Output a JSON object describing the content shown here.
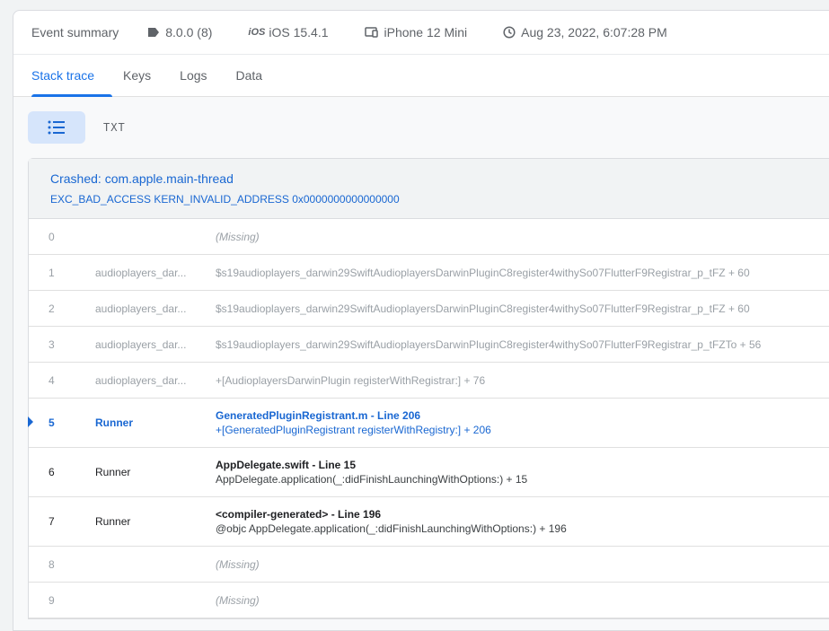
{
  "summary": {
    "title": "Event summary",
    "version": "8.0.0 (8)",
    "os": "iOS 15.4.1",
    "os_glyph": "iOS",
    "device": "iPhone 12 Mini",
    "timestamp": "Aug 23, 2022, 6:07:28 PM"
  },
  "tabs": [
    {
      "label": "Stack trace",
      "active": true
    },
    {
      "label": "Keys"
    },
    {
      "label": "Logs"
    },
    {
      "label": "Data"
    }
  ],
  "view_toggle": {
    "txt_label": "TXT"
  },
  "crash": {
    "title": "Crashed: com.apple.main-thread",
    "subtitle": "EXC_BAD_ACCESS KERN_INVALID_ADDRESS 0x0000000000000000"
  },
  "frames": [
    {
      "num": "0",
      "lib": "",
      "symbol": "(Missing)"
    },
    {
      "num": "1",
      "lib": "audioplayers_dar...",
      "symbol": "$s19audioplayers_darwin29SwiftAudioplayersDarwinPluginC8register4withySo07FlutterF9Registrar_p_tFZ + 60"
    },
    {
      "num": "2",
      "lib": "audioplayers_dar...",
      "symbol": "$s19audioplayers_darwin29SwiftAudioplayersDarwinPluginC8register4withySo07FlutterF9Registrar_p_tFZ + 60"
    },
    {
      "num": "3",
      "lib": "audioplayers_dar...",
      "symbol": "$s19audioplayers_darwin29SwiftAudioplayersDarwinPluginC8register4withySo07FlutterF9Registrar_p_tFZTo + 56"
    },
    {
      "num": "4",
      "lib": "audioplayers_dar...",
      "symbol": "+[AudioplayersDarwinPlugin registerWithRegistrar:] + 76"
    },
    {
      "num": "5",
      "lib": "Runner",
      "file": "GeneratedPluginRegistrant.m - Line 206",
      "symbol": "+[GeneratedPluginRegistrant registerWithRegistry:] + 206"
    },
    {
      "num": "6",
      "lib": "Runner",
      "file": "AppDelegate.swift - Line 15",
      "symbol": "AppDelegate.application(_:didFinishLaunchingWithOptions:) + 15"
    },
    {
      "num": "7",
      "lib": "Runner",
      "file": "<compiler-generated> - Line 196",
      "symbol": "@objc AppDelegate.application(_:didFinishLaunchingWithOptions:) + 196"
    },
    {
      "num": "8",
      "lib": "",
      "symbol": "(Missing)"
    },
    {
      "num": "9",
      "lib": "",
      "symbol": "(Missing)"
    }
  ],
  "colors": {
    "accent": "#1a73e8",
    "link": "#1967d2",
    "dim": "#9aa0a6"
  }
}
